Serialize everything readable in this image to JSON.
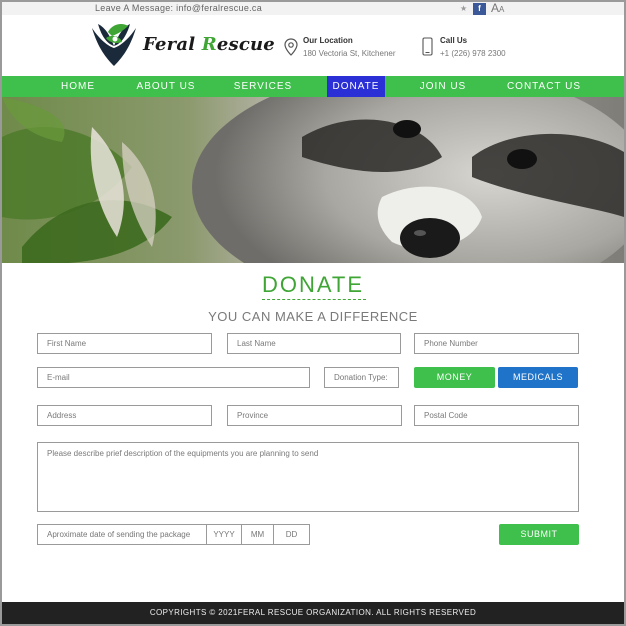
{
  "topbar": {
    "message": "Leave A Message: info@feralrescue.ca",
    "twitter_icon": "twitter-icon",
    "facebook_icon": "facebook-icon",
    "font_size_label": "A",
    "font_size_label_small": "A"
  },
  "brand": {
    "name_part1": "Feral ",
    "name_part2": "R",
    "name_part3": "escue"
  },
  "location": {
    "title": "Our Location",
    "address": "180 Vectoria St, Kitchener"
  },
  "call": {
    "title": "Call Us",
    "phone": "+1 (226) 978 2300"
  },
  "nav": {
    "items": [
      "HOME",
      "ABOUT US",
      "SERVICES",
      "DONATE",
      "JOIN US",
      "CONTACT US"
    ],
    "active": "DONATE"
  },
  "donate": {
    "title": "DONATE",
    "subtitle": "YOU CAN MAKE A DIFFERENCE"
  },
  "form": {
    "first_name_placeholder": "First Name",
    "last_name_placeholder": "Last Name",
    "phone_placeholder": "Phone Number",
    "email_placeholder": "E-mail",
    "donation_type_label": "Donation Type:",
    "money_label": "MONEY",
    "medicals_label": "MEDICALS",
    "address_placeholder": "Address",
    "province_placeholder": "Province",
    "postal_placeholder": "Postal Code",
    "description_placeholder": "Please describe prief description of the equipments you are planning to send",
    "date_label": "Aproximate date of sending the package",
    "yyyy": "YYYY",
    "mm": "MM",
    "dd": "DD",
    "submit_label": "SUBMIT"
  },
  "footer": {
    "text": "COPYRIGHTS © 2021FERAL RESCUE ORGANIZATION. ALL RIGHTS RESERVED"
  },
  "colors": {
    "green": "#3fbf4b",
    "brand_green": "#3fa535",
    "active_nav": "#2a2fd6",
    "blue_button": "#1f73c8",
    "footer_bg": "#222222"
  }
}
